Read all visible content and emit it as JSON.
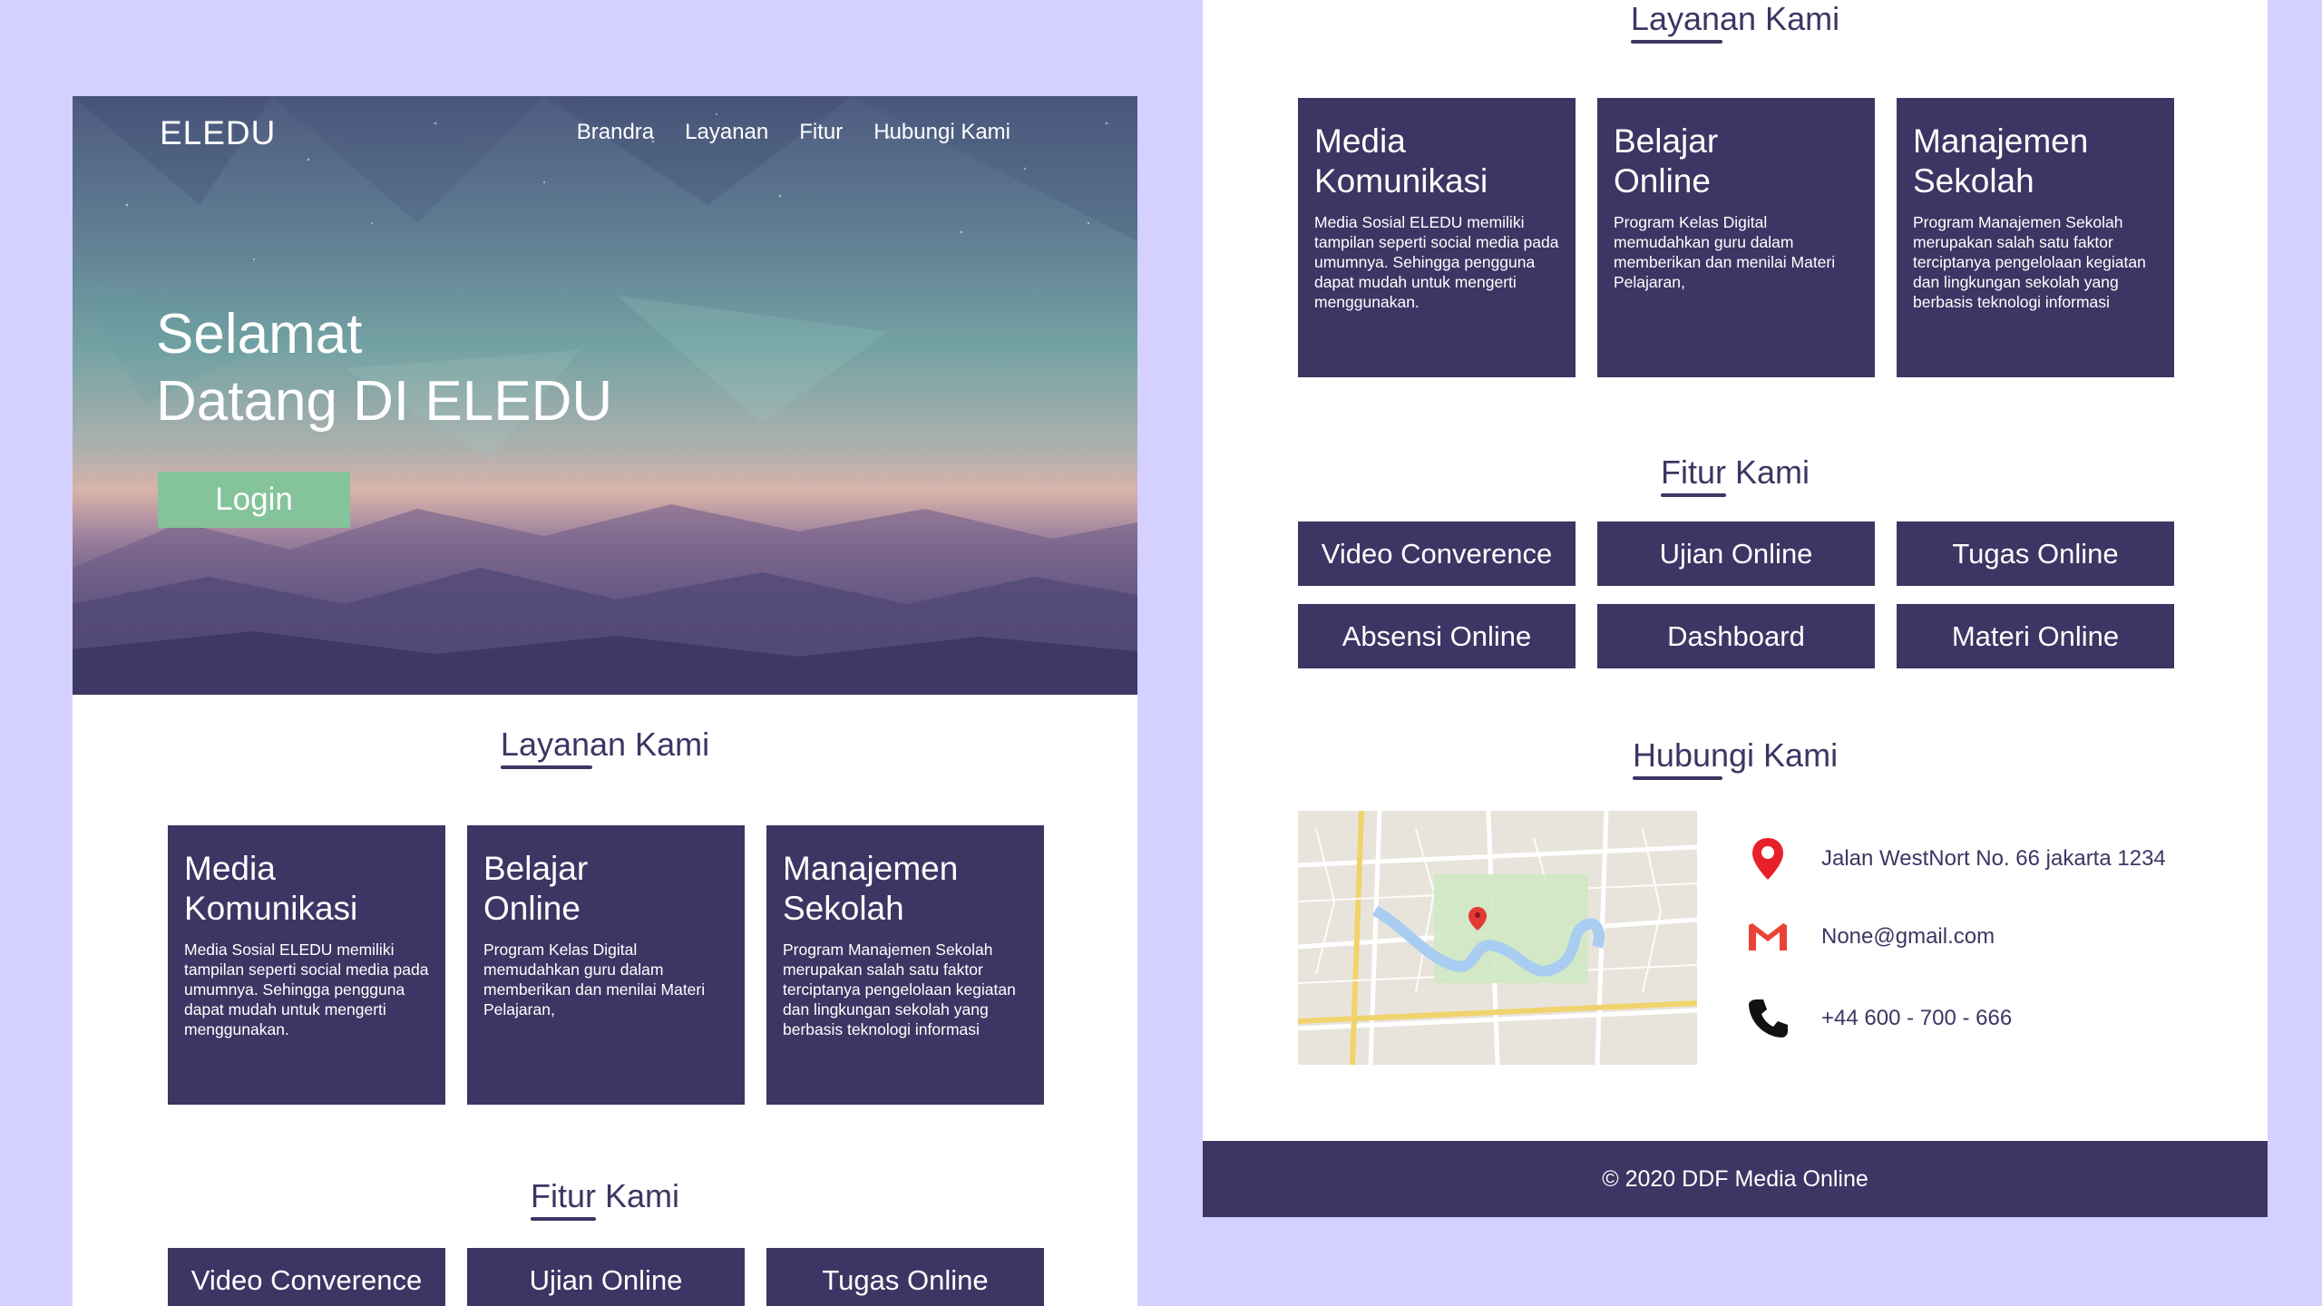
{
  "brand": "ELEDU",
  "nav": [
    "Brandra",
    "Layanan",
    "Fitur",
    "Hubungi Kami"
  ],
  "hero": {
    "title_line1": "Selamat",
    "title_line2": "Datang DI ELEDU",
    "login_label": "Login"
  },
  "layanan": {
    "title": "Layanan Kami",
    "cards": [
      {
        "title1": "Media",
        "title2": "Komunikasi",
        "desc": "Media Sosial ELEDU memiliki tampilan seperti social media pada umumnya. Sehingga pengguna dapat mudah untuk mengerti menggunakan."
      },
      {
        "title1": "Belajar",
        "title2": "Online",
        "desc": "Program Kelas Digital memudahkan guru dalam memberikan dan menilai Materi Pelajaran,"
      },
      {
        "title1": "Manajemen",
        "title2": "Sekolah",
        "desc": "Program Manajemen Sekolah merupakan salah satu faktor terciptanya pengelolaan kegiatan dan lingkungan sekolah yang berbasis teknologi informasi"
      }
    ]
  },
  "fitur": {
    "title": "Fitur Kami",
    "items": [
      "Video Converence",
      "Ujian Online",
      "Tugas Online",
      "Absensi Online",
      "Dashboard",
      "Materi Online"
    ]
  },
  "hubungi": {
    "title": "Hubungi Kami",
    "address": "Jalan WestNort No. 66 jakarta 1234",
    "email": "None@gmail.com",
    "phone": "+44 600 - 700 - 666"
  },
  "footer": "© 2020 DDF Media Online",
  "icons": [
    "location-pin-icon",
    "gmail-icon",
    "phone-icon",
    "map-marker-icon"
  ],
  "colors": {
    "background": "#d4d0ff",
    "primary": "#3b3663",
    "login": "#85c39b",
    "white": "#ffffff"
  }
}
